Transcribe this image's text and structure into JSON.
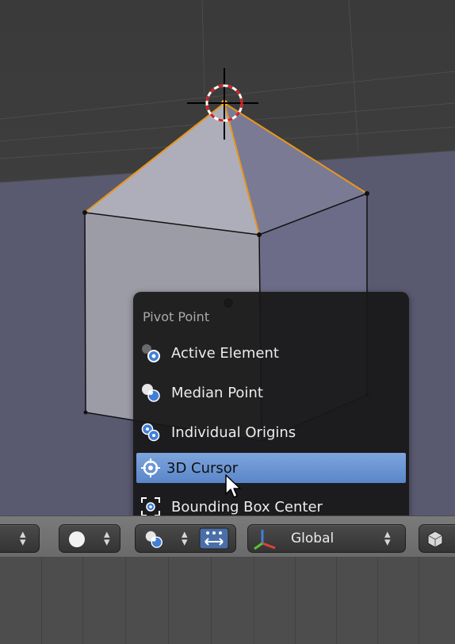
{
  "pivot_menu": {
    "title": "Pivot Point",
    "items": [
      {
        "label": "Active Element",
        "icon": "active-element-icon"
      },
      {
        "label": "Median Point",
        "icon": "median-point-icon"
      },
      {
        "label": "Individual Origins",
        "icon": "individual-origins-icon"
      },
      {
        "label": "3D Cursor",
        "icon": "3d-cursor-icon",
        "selected": true
      },
      {
        "label": "Bounding Box Center",
        "icon": "bounding-box-center-icon"
      }
    ]
  },
  "header": {
    "transform_orientation": "Global"
  },
  "colors": {
    "menu_bg": "#181818",
    "highlight": "#6b96d4",
    "selected_edge": "#f0a020",
    "cursor_red": "#d02020"
  }
}
